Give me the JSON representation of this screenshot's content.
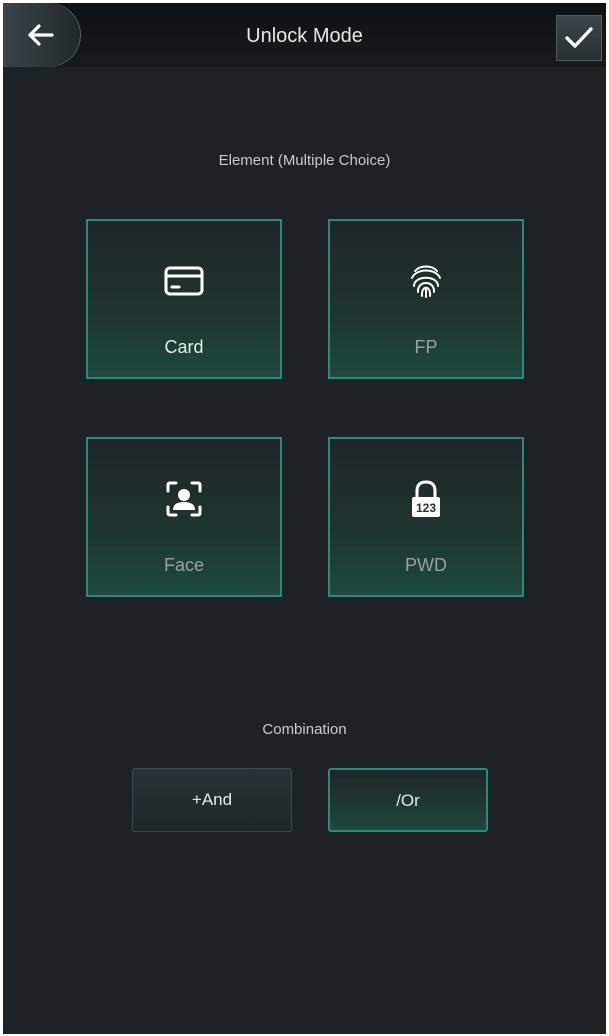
{
  "header": {
    "title": "Unlock Mode",
    "back_icon": "arrow-left-icon",
    "confirm_icon": "check-icon"
  },
  "elements": {
    "label": "Element (Multiple Choice)",
    "items": [
      {
        "label": "Card",
        "icon": "card-icon",
        "selected": true
      },
      {
        "label": "FP",
        "icon": "fingerprint-icon",
        "selected": false
      },
      {
        "label": "Face",
        "icon": "face-icon",
        "selected": false
      },
      {
        "label": "PWD",
        "icon": "password-lock-icon",
        "icon_text": "123",
        "selected": false
      }
    ]
  },
  "combination": {
    "label": "Combination",
    "and_label": "+And",
    "or_label": "/Or",
    "selected": "Or"
  },
  "colors": {
    "background": "#1c2226",
    "header": "#121618",
    "accent": "#2c8a76",
    "text": "#e6e9ea"
  }
}
